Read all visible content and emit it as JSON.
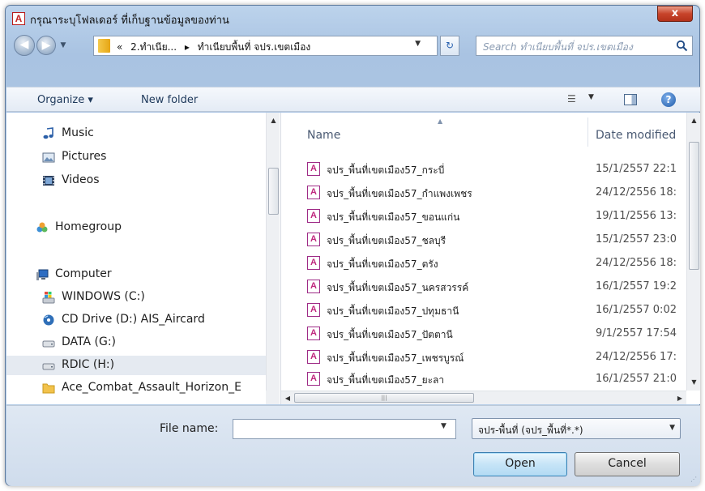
{
  "window": {
    "title": "กรุณาระบุโฟลเดอร์ ที่เก็บฐานข้อมูลของท่าน",
    "app_icon_letter": "A",
    "close_glyph": "x"
  },
  "navigation": {
    "back_glyph": "◀",
    "forward_glyph": "▶",
    "history_glyph": "▼",
    "address_crumbs": [
      "«",
      "2.ทำเนีย...",
      "▸",
      "ทำเนียบพื้นที่ จปร.เขตเมือง"
    ],
    "address_drop_glyph": "▼",
    "refresh_glyph": "↻",
    "search_placeholder": "Search ทำเนียบพื้นที่ จปร.เขตเมือง"
  },
  "toolbar": {
    "organize_label": "Organize ▾",
    "new_folder_label": "New folder",
    "view_glyph": "☰",
    "view_drop_glyph": "▼",
    "help_glyph": "?"
  },
  "nav_pane": {
    "items": [
      {
        "label": "Music",
        "icon": "music-icon"
      },
      {
        "label": "Pictures",
        "icon": "pictures-icon"
      },
      {
        "label": "Videos",
        "icon": "videos-icon"
      },
      {
        "label": "Homegroup",
        "icon": "homegroup-icon"
      },
      {
        "label": "Computer",
        "icon": "computer-icon"
      },
      {
        "label": "WINDOWS (C:)",
        "icon": "windows-drive-icon"
      },
      {
        "label": "CD Drive (D:) AIS_Aircard",
        "icon": "cd-drive-icon"
      },
      {
        "label": "DATA (G:)",
        "icon": "drive-icon"
      },
      {
        "label": "RDIC (H:)",
        "icon": "drive-icon"
      },
      {
        "label": "Ace_Combat_Assault_Horizon_E",
        "icon": "folder-icon"
      }
    ],
    "selected": "RDIC (H:)"
  },
  "file_list": {
    "columns": {
      "name": "Name",
      "date": "Date modified"
    },
    "rows": [
      {
        "name": "จปร_พื้นที่เขตเมือง57_กระบี่",
        "date": "15/1/2557 22:1"
      },
      {
        "name": "จปร_พื้นที่เขตเมือง57_กำแพงเพชร",
        "date": "24/12/2556 18:"
      },
      {
        "name": "จปร_พื้นที่เขตเมือง57_ขอนแก่น",
        "date": "19/11/2556 13:"
      },
      {
        "name": "จปร_พื้นที่เขตเมือง57_ชลบุรี",
        "date": "15/1/2557 23:0"
      },
      {
        "name": "จปร_พื้นที่เขตเมือง57_ตรัง",
        "date": "24/12/2556 18:"
      },
      {
        "name": "จปร_พื้นที่เขตเมือง57_นครสวรรค์",
        "date": "16/1/2557 19:2"
      },
      {
        "name": "จปร_พื้นที่เขตเมือง57_ปทุมธานี",
        "date": "16/1/2557 0:02"
      },
      {
        "name": "จปร_พื้นที่เขตเมือง57_ปัตตานี",
        "date": "9/1/2557 17:54"
      },
      {
        "name": "จปร_พื้นที่เขตเมือง57_เพชรบูรณ์",
        "date": "24/12/2556 17:"
      },
      {
        "name": "จปร_พื้นที่เขตเมือง57_ยะลา",
        "date": "16/1/2557 21:0"
      }
    ],
    "file_icon_letter": "A"
  },
  "footer": {
    "file_name_label": "File name:",
    "file_name_value": "",
    "filter_value": "จปร-พื้นที่ (จปร_พื้นที่*.*)",
    "drop_glyph": "▼",
    "open_label": "Open",
    "cancel_label": "Cancel"
  },
  "colors": {
    "frame": "#a9c3e2",
    "close_button": "#c7432a",
    "selection": "#e5eaf1",
    "link_text": "#1e395b"
  }
}
